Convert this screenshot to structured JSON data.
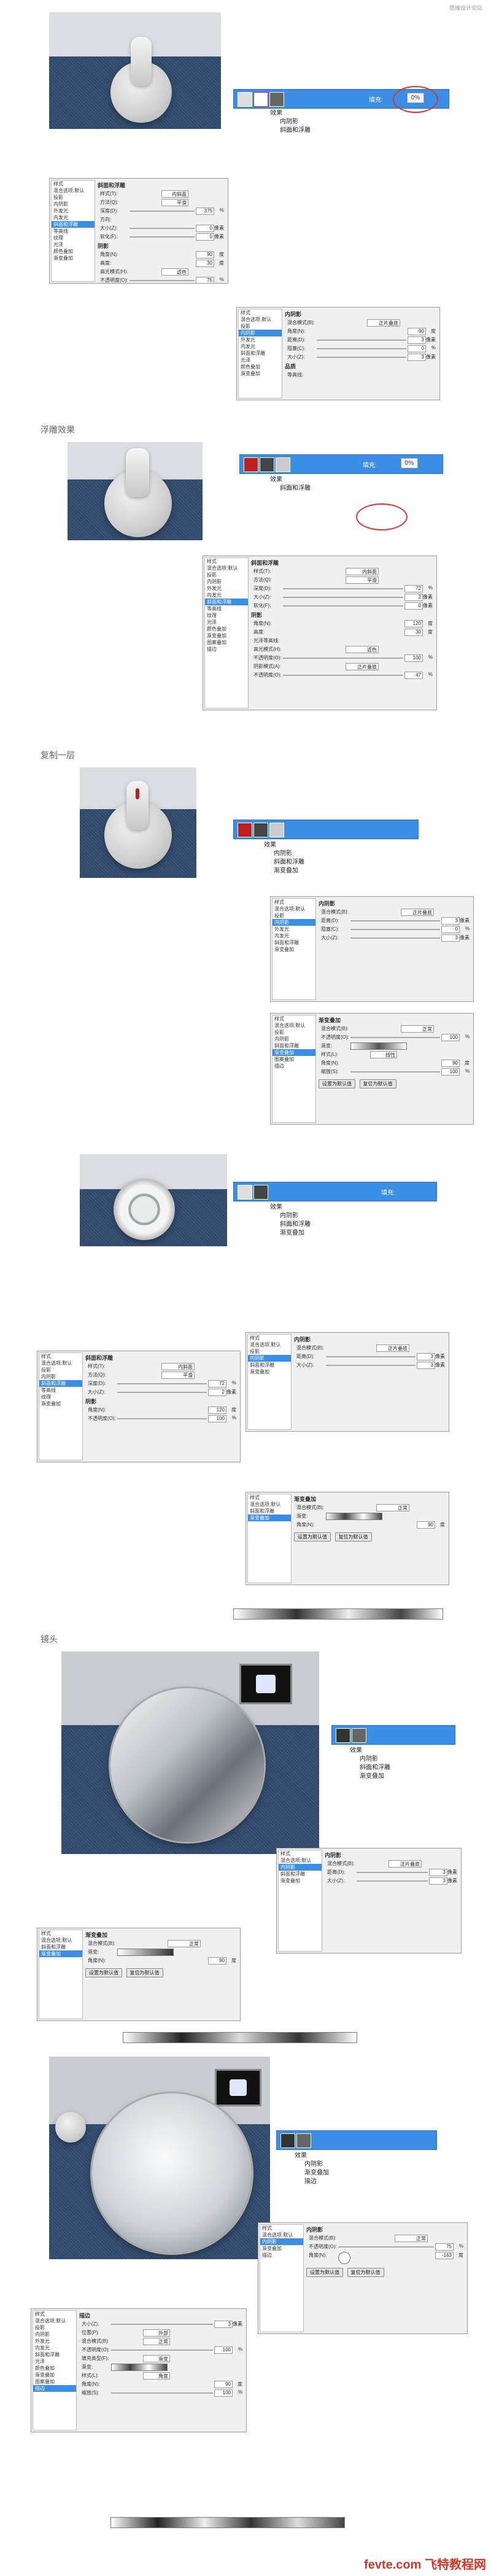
{
  "watermark": "思缘设计论坛",
  "section_titles": [
    "浮雕效果",
    "复制一层",
    "镜头"
  ],
  "layer": {
    "fill_label": "填充:",
    "fill_value": "0%",
    "effects_label": "效果",
    "inner_shadow": "内阴影",
    "bevel": "斜面和浮雕",
    "gradient_overlay": "渐变叠加",
    "stroke": "描边",
    "shadow": "投影"
  },
  "style_list": [
    "样式",
    "混合选项:默认",
    "投影",
    "内阴影",
    "外发光",
    "内发光",
    "斜面和浮雕",
    "等高线",
    "纹理",
    "光泽",
    "颜色叠加",
    "渐变叠加",
    "图案叠加",
    "描边"
  ],
  "panel": {
    "bevel_title": "斜面和浮雕",
    "structure": "结构",
    "style_label": "样式(T):",
    "style_value": "内斜面",
    "method_label": "方法(Q):",
    "method_value": "平滑",
    "depth_label": "深度(D):",
    "direction_label": "方向:",
    "dir_up": "上",
    "dir_down": "下",
    "size_label": "大小(Z):",
    "soften_label": "软化(F):",
    "shading": "阴影",
    "angle_label": "角度(N):",
    "altitude_label": "高度:",
    "global_light": "使用全局光(G)",
    "gloss_label": "光泽等高线:",
    "antialias": "消除锯齿(L)",
    "highlight_label": "高光模式(H):",
    "highlight_value": "滤色",
    "opacity_label": "不透明度(O):",
    "shadow_mode_label": "阴影模式(A):",
    "shadow_mode_value": "正片叠底",
    "px": "像素",
    "deg": "度",
    "pct": "%",
    "inner_shadow_title": "内阴影",
    "blend_label": "混合模式(B):",
    "blend_value": "正片叠底",
    "distance_label": "距离(D):",
    "choke_label": "阻塞(C):",
    "quality": "品质",
    "contour_label": "等高线:",
    "noise_label": "杂色(N):",
    "grad_title": "渐变叠加",
    "gradient": "渐变",
    "normal": "正常",
    "gradient_label": "渐变:",
    "reverse": "反向(R)",
    "gstyle_label": "样式(L):",
    "linear": "线性",
    "align_layer": "与图层对齐(I)",
    "scale_label": "缩放(S):",
    "set_default": "设置为默认值",
    "reset_default": "复位为默认值",
    "stroke_title": "描边",
    "position_label": "位置(P):",
    "outside": "外部",
    "fill_type_label": "填充类型(F):",
    "angle_type": "角度",
    "dither": "仿色"
  },
  "values": {
    "depth_a": "375",
    "size_a": "0",
    "soften_a": "0",
    "angle_a": "90",
    "altitude_a": "30",
    "opacity_h_a": "75",
    "opacity_s_a": "75",
    "depth_b": "72",
    "size_b": "2",
    "soften_b": "0",
    "angle_b": "120",
    "altitude_b": "30",
    "opacity_h_b": "100",
    "opacity_s_b": "47",
    "is_distance": "3",
    "is_choke": "0",
    "is_size": "3",
    "is_angle": "-90",
    "gr_opacity": "100",
    "gr_angle": "90",
    "gr_scale": "100",
    "st_size": "3",
    "st_opacity": "100",
    "st_angle": "90",
    "st_scale": "100",
    "c_depth": "100",
    "c_size": "1",
    "c_angle": "-163",
    "c_opacity": "75"
  },
  "logo": "fevte.com 飞特教程网"
}
